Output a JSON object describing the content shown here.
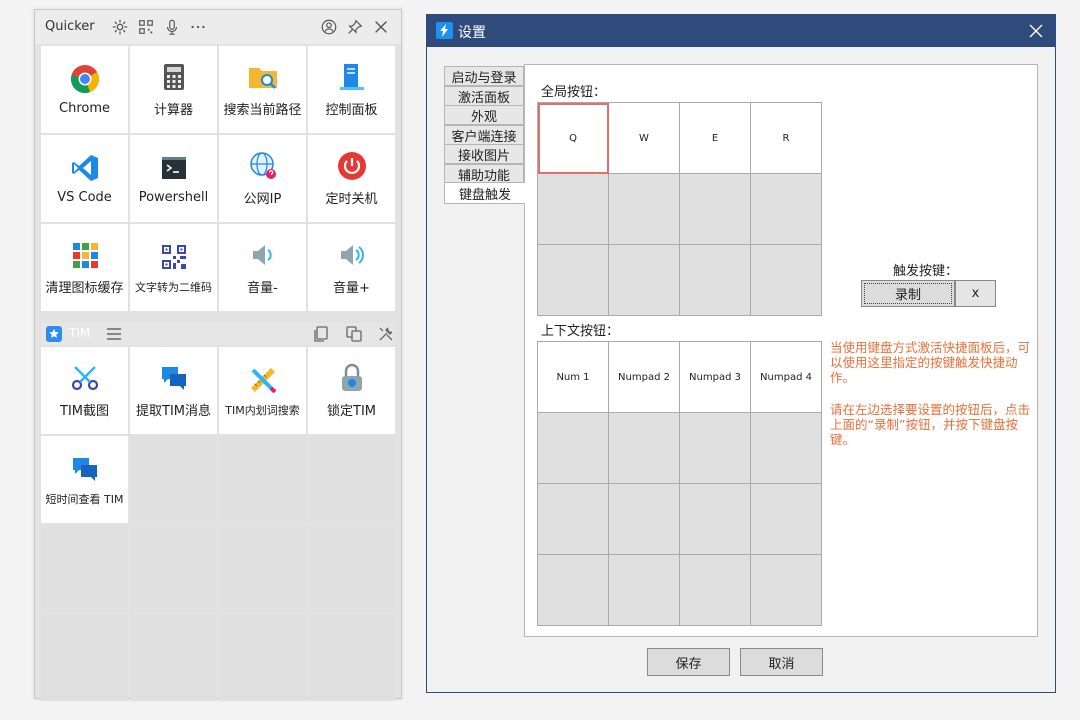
{
  "quicker": {
    "title": "Quicker",
    "grid1": [
      {
        "label": "Chrome",
        "icon": "chrome-icon"
      },
      {
        "label": "计算器",
        "icon": "calculator-icon"
      },
      {
        "label": "搜索当前路径",
        "icon": "folder-search-icon"
      },
      {
        "label": "控制面板",
        "icon": "control-panel-icon"
      },
      {
        "label": "VS Code",
        "icon": "vscode-icon"
      },
      {
        "label": "Powershell",
        "icon": "powershell-icon"
      },
      {
        "label": "公网IP",
        "icon": "globe-ip-icon"
      },
      {
        "label": "定时关机",
        "icon": "power-icon"
      },
      {
        "label": "清理图标缓存",
        "icon": "icon-grid-icon"
      },
      {
        "label": "文字转为二维码",
        "icon": "qrcode-icon"
      },
      {
        "label": "音量-",
        "icon": "volume-down-icon"
      },
      {
        "label": "音量+",
        "icon": "volume-up-icon"
      }
    ],
    "tim_label": "TIM",
    "grid2": [
      {
        "label": "TIM截图",
        "icon": "scissors-icon"
      },
      {
        "label": "提取TIM消息",
        "icon": "chat-icon"
      },
      {
        "label": "TIM内划词搜索",
        "icon": "ruler-pencil-icon"
      },
      {
        "label": "锁定TIM",
        "icon": "lock-icon"
      },
      {
        "label": "短时间查看 TIM",
        "icon": "chat-icon"
      }
    ]
  },
  "settings": {
    "title": "设置",
    "tabs": [
      "启动与登录",
      "激活面板",
      "外观",
      "客户端连接",
      "接收图片",
      "辅助功能",
      "键盘触发"
    ],
    "active_tab": "键盘触发",
    "global_label": "全局按钮：",
    "global_keys": [
      "Q",
      "W",
      "E",
      "R",
      "",
      "",
      "",
      "",
      "",
      "",
      "",
      ""
    ],
    "context_label": "上下文按钮：",
    "context_keys": [
      "Num 1",
      "Numpad 2",
      "Numpad 3",
      "Numpad 4",
      "",
      "",
      "",
      "",
      "",
      "",
      "",
      "",
      "",
      "",
      "",
      ""
    ],
    "trigger_label": "触发按键：",
    "record_label": "录制",
    "clear_label": "x",
    "hint1": "当使用键盘方式激活快捷面板后，可以使用这里指定的按键触发快捷动作。",
    "hint2": "请在左边选择要设置的按钮后，点击上面的“录制”按钮，并按下键盘按键。",
    "save_label": "保存",
    "cancel_label": "取消",
    "colors": {
      "titlebar": "#2f4b7c",
      "hint": "#e8703a",
      "selected_border": "#e07070"
    }
  }
}
